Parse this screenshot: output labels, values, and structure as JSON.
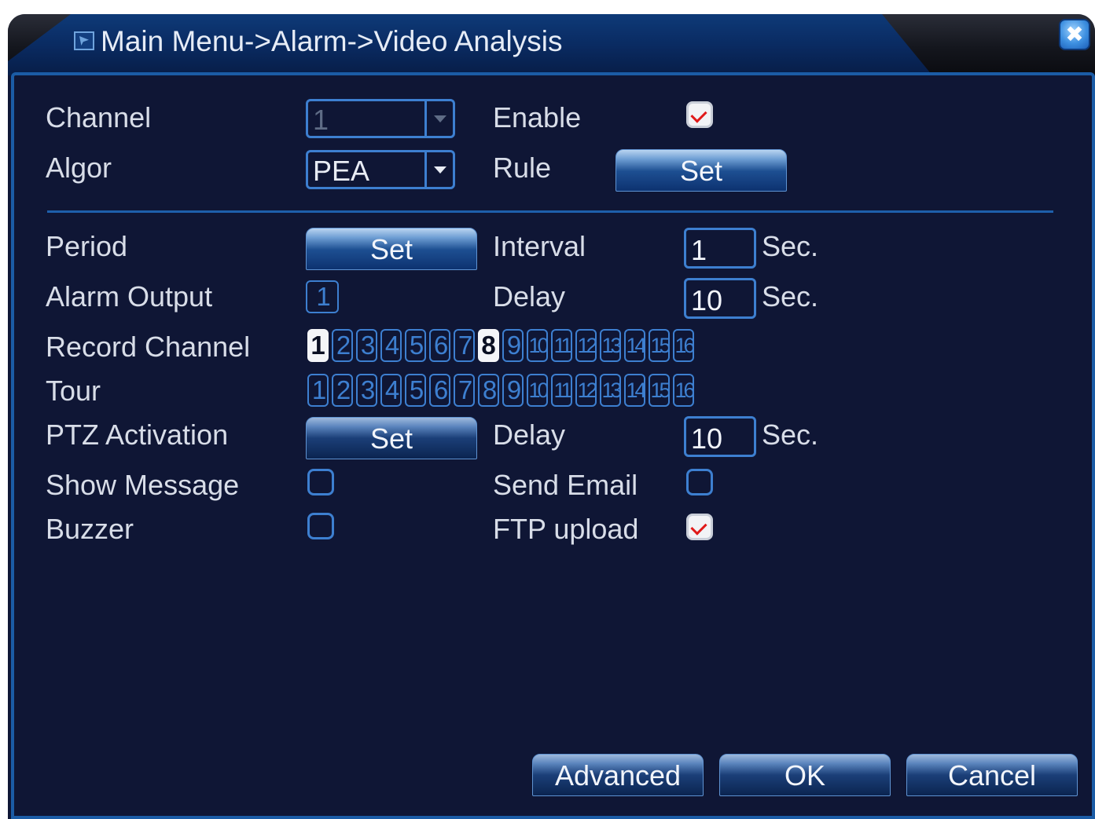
{
  "window": {
    "title": "Main Menu->Alarm->Video Analysis",
    "close_label": "✖"
  },
  "channel": {
    "label": "Channel",
    "value": "1",
    "enabled": false
  },
  "enable": {
    "label": "Enable",
    "checked": true
  },
  "algor": {
    "label": "Algor",
    "value": "PEA"
  },
  "rule": {
    "label": "Rule",
    "button": "Set"
  },
  "period": {
    "label": "Period",
    "button": "Set"
  },
  "interval": {
    "label": "Interval",
    "value": "1",
    "unit": "Sec."
  },
  "alarm_output": {
    "label": "Alarm Output",
    "channels": [
      "1"
    ]
  },
  "delay1": {
    "label": "Delay",
    "value": "10",
    "unit": "Sec."
  },
  "record_channel": {
    "label": "Record Channel",
    "channels": [
      "1",
      "2",
      "3",
      "4",
      "5",
      "6",
      "7",
      "8",
      "9",
      "10",
      "11",
      "12",
      "13",
      "14",
      "15",
      "16"
    ],
    "selected": [
      "1",
      "8"
    ]
  },
  "tour": {
    "label": "Tour",
    "channels": [
      "1",
      "2",
      "3",
      "4",
      "5",
      "6",
      "7",
      "8",
      "9",
      "10",
      "11",
      "12",
      "13",
      "14",
      "15",
      "16"
    ],
    "selected": []
  },
  "ptz": {
    "label": "PTZ Activation",
    "button": "Set"
  },
  "delay2": {
    "label": "Delay",
    "value": "10",
    "unit": "Sec."
  },
  "show_message": {
    "label": "Show Message",
    "checked": false
  },
  "send_email": {
    "label": "Send Email",
    "checked": false
  },
  "buzzer": {
    "label": "Buzzer",
    "checked": false
  },
  "ftp_upload": {
    "label": "FTP upload",
    "checked": true
  },
  "footer": {
    "advanced": "Advanced",
    "ok": "OK",
    "cancel": "Cancel"
  },
  "colors": {
    "background": "#0f1635",
    "accent": "#3d7fd0",
    "check": "#e01a1a"
  }
}
